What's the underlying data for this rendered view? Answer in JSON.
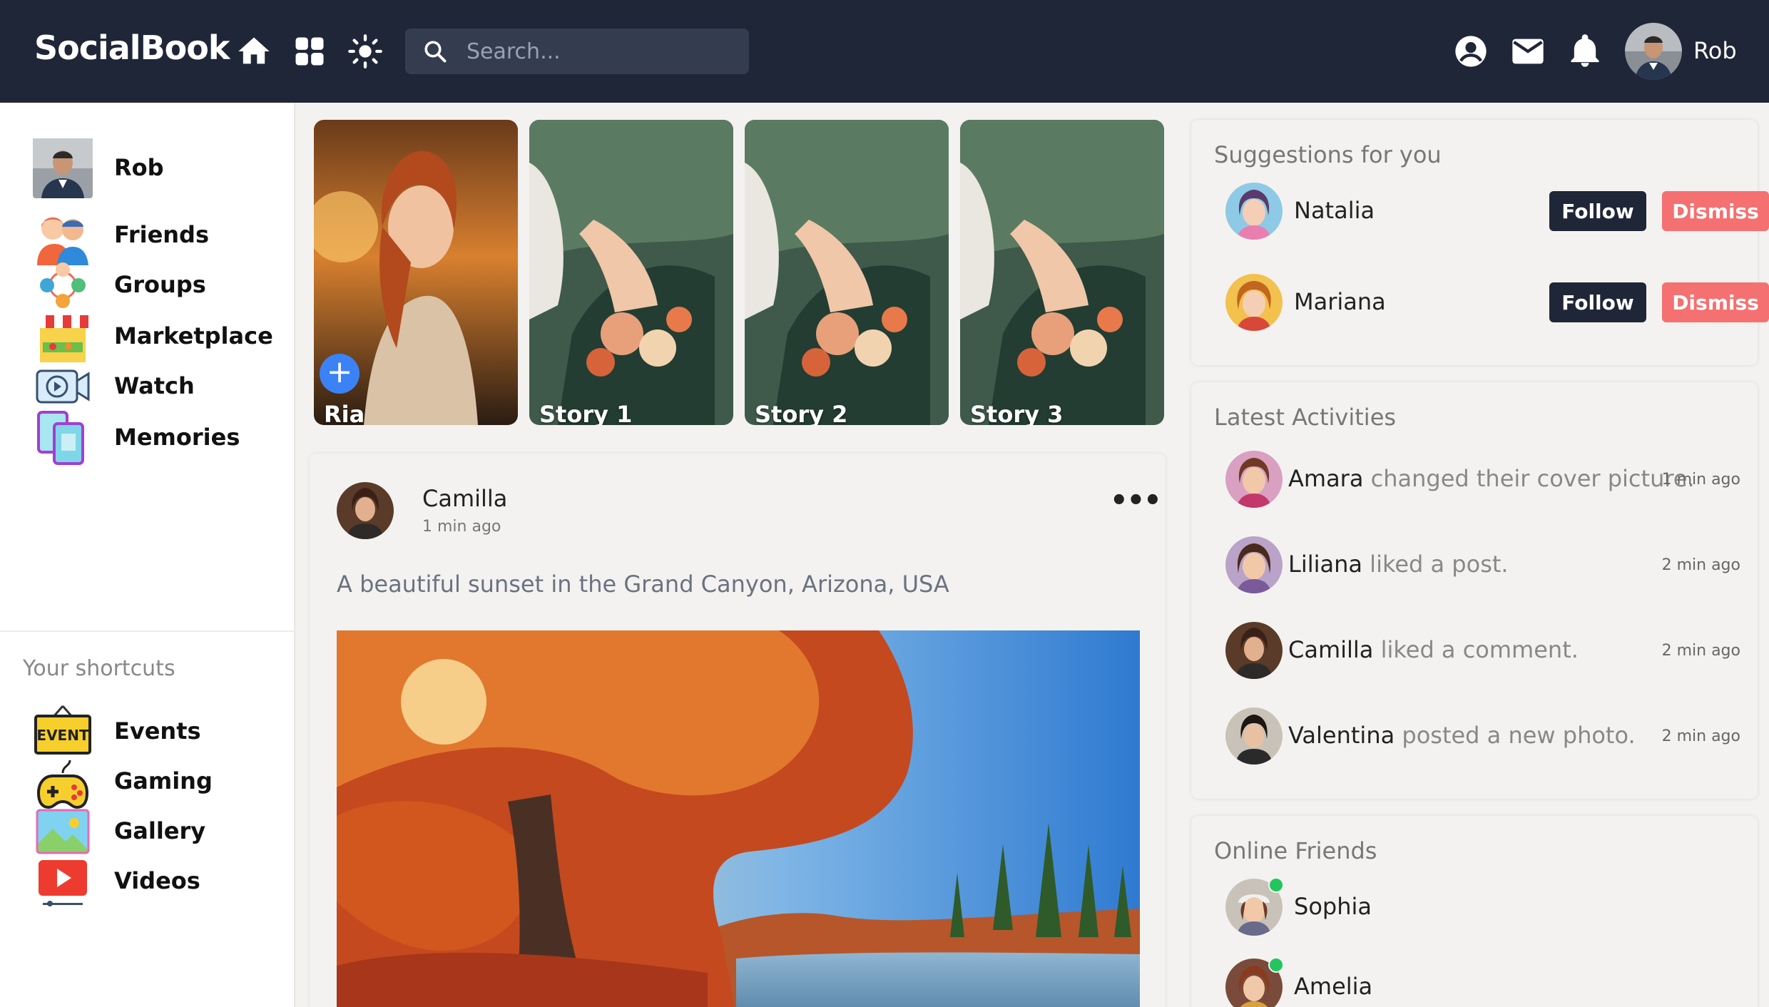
{
  "header": {
    "brand": "SocialBook",
    "search_placeholder": "Search...",
    "username": "Rob",
    "icons": [
      "home-icon",
      "grid-icon",
      "sun-icon",
      "search-icon",
      "account-icon",
      "mail-icon",
      "bell-icon"
    ]
  },
  "sidebar": {
    "items": [
      {
        "label": "Rob",
        "icon": "profile-avatar"
      },
      {
        "label": "Friends",
        "icon": "friends-icon"
      },
      {
        "label": "Groups",
        "icon": "groups-icon"
      },
      {
        "label": "Marketplace",
        "icon": "marketplace-icon"
      },
      {
        "label": "Watch",
        "icon": "watch-icon"
      },
      {
        "label": "Memories",
        "icon": "memories-icon"
      }
    ],
    "shortcuts_title": "Your shortcuts",
    "shortcuts": [
      {
        "label": "Events",
        "icon": "events-icon",
        "badge": "EVENT"
      },
      {
        "label": "Gaming",
        "icon": "gaming-icon"
      },
      {
        "label": "Gallery",
        "icon": "gallery-icon"
      },
      {
        "label": "Videos",
        "icon": "videos-icon"
      }
    ]
  },
  "stories": [
    {
      "label": "Ria",
      "has_add": true
    },
    {
      "label": "Story 1"
    },
    {
      "label": "Story 2"
    },
    {
      "label": "Story 3"
    }
  ],
  "post": {
    "author": "Camilla",
    "time": "1 min ago",
    "text": "A beautiful sunset in the Grand Canyon, Arizona, USA",
    "menu": "•••"
  },
  "suggestions": {
    "title": "Suggestions for you",
    "follow_label": "Follow",
    "dismiss_label": "Dismiss",
    "people": [
      {
        "name": "Natalia"
      },
      {
        "name": "Mariana"
      }
    ]
  },
  "activities": {
    "title": "Latest Activities",
    "items": [
      {
        "name": "Amara",
        "action": "changed their cover picture.",
        "time": "1 min ago"
      },
      {
        "name": "Liliana",
        "action": "liked a post.",
        "time": "2 min ago"
      },
      {
        "name": "Camilla",
        "action": "liked a comment.",
        "time": "2 min ago"
      },
      {
        "name": "Valentina",
        "action": "posted a new photo.",
        "time": "2 min ago"
      }
    ]
  },
  "online_friends": {
    "title": "Online Friends",
    "people": [
      {
        "name": "Sophia",
        "status": "online"
      },
      {
        "name": "Amelia",
        "status": "online"
      }
    ]
  },
  "colors": {
    "topbar": "#1f2637",
    "follow_button": "#1f2637",
    "dismiss_button": "#f57070",
    "online": "#22c55e",
    "story_add": "#3b82f6"
  }
}
